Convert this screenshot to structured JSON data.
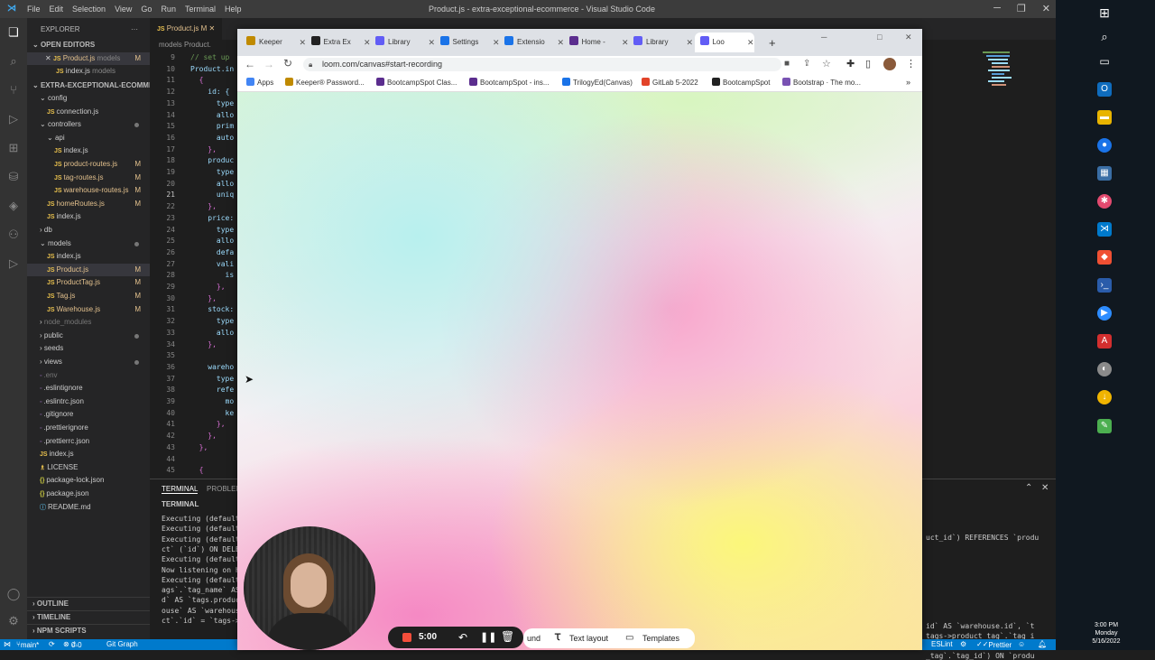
{
  "vscode": {
    "menu": [
      "File",
      "Edit",
      "Selection",
      "View",
      "Go",
      "Run",
      "Terminal",
      "Help"
    ],
    "window_title": "Product.js - extra-exceptional-ecommerce - Visual Studio Code",
    "tab_label": "Product.js M",
    "breadcrumb": "models  Product.",
    "explorer_title": "EXPLORER",
    "open_editors": "OPEN EDITORS",
    "open_editor_items": [
      {
        "name": "Product.js",
        "path": "models",
        "mark": "M"
      },
      {
        "name": "index.js",
        "path": "models",
        "mark": ""
      }
    ],
    "project": "EXTRA-EXCEPTIONAL-ECOMME...",
    "tree": [
      {
        "label": "config",
        "mark": ""
      },
      {
        "label": "connection.js",
        "mark": ""
      },
      {
        "label": "controllers",
        "mark": ""
      },
      {
        "label": "api",
        "mark": ""
      },
      {
        "label": "index.js",
        "mark": ""
      },
      {
        "label": "product-routes.js",
        "mark": "M"
      },
      {
        "label": "tag-routes.js",
        "mark": "M"
      },
      {
        "label": "warehouse-routes.js",
        "mark": "M"
      },
      {
        "label": "homeRoutes.js",
        "mark": "M"
      },
      {
        "label": "index.js",
        "mark": ""
      },
      {
        "label": "db",
        "mark": ""
      },
      {
        "label": "models",
        "mark": ""
      },
      {
        "label": "index.js",
        "mark": ""
      },
      {
        "label": "Product.js",
        "mark": "M"
      },
      {
        "label": "ProductTag.js",
        "mark": "M"
      },
      {
        "label": "Tag.js",
        "mark": "M"
      },
      {
        "label": "Warehouse.js",
        "mark": "M"
      },
      {
        "label": "node_modules",
        "mark": ""
      },
      {
        "label": "public",
        "mark": ""
      },
      {
        "label": "seeds",
        "mark": ""
      },
      {
        "label": "views",
        "mark": ""
      },
      {
        "label": ".env",
        "mark": ""
      },
      {
        "label": ".eslintignore",
        "mark": ""
      },
      {
        "label": ".eslintrc.json",
        "mark": ""
      },
      {
        "label": ".gitignore",
        "mark": ""
      },
      {
        "label": ".prettierignore",
        "mark": ""
      },
      {
        "label": ".prettierrc.json",
        "mark": ""
      },
      {
        "label": "index.js",
        "mark": ""
      },
      {
        "label": "LICENSE",
        "mark": ""
      },
      {
        "label": "package-lock.json",
        "mark": ""
      },
      {
        "label": "package.json",
        "mark": ""
      },
      {
        "label": "README.md",
        "mark": ""
      }
    ],
    "outline": "OUTLINE",
    "timeline": "TIMELINE",
    "npm": "NPM SCRIPTS",
    "line_numbers": [
      "9",
      "10",
      "11",
      "12",
      "13",
      "14",
      "15",
      "16",
      "17",
      "18",
      "19",
      "20",
      "21",
      "22",
      "23",
      "24",
      "25",
      "26",
      "27",
      "28",
      "29",
      "30",
      "31",
      "32",
      "33",
      "34",
      "35",
      "36",
      "37",
      "38",
      "39",
      "40",
      "41",
      "42",
      "43",
      "44",
      "45"
    ],
    "code_lines": [
      "// set up",
      "Product.in",
      "  {",
      "    id: {",
      "      type",
      "      allo",
      "      prim",
      "      auto",
      "    },",
      "    produc",
      "      type",
      "      allo",
      "      uniq",
      "    },",
      "    price:",
      "      type",
      "      allo",
      "      defa",
      "      vali",
      "        is",
      "      },",
      "    },",
      "    stock:",
      "      type",
      "      allo",
      "    },",
      "",
      "    wareho",
      "      type",
      "      refe",
      "        mo",
      "        ke",
      "      },",
      "    },",
      "  },",
      "",
      "  {"
    ],
    "panel_tabs": [
      "TERMINAL",
      "PROBLEM"
    ],
    "terminal_label": "TERMINAL",
    "terminal_left": [
      "Executing (default",
      "Executing (default",
      "Executing (default",
      "ct` (`id`) ON DELE",
      "Executing (default",
      "Now listening on h",
      "Executing (default",
      "ags`.`tag_name` AS",
      "d` AS `tags.produc",
      "ouse` AS `warehous",
      "ct`.`id` = `tags->"
    ],
    "terminal_right": [
      "uct_id`) REFERENCES `produ",
      "",
      "",
      "id` AS `warehouse.id`, `t",
      "tags->product_tag`.`tag_i",
      "` LEFT OUTER JOIN `wareh",
      "_tag`.`tag_id`) ON `produ"
    ],
    "status": {
      "branch": "main*",
      "errors": "0",
      "warnings": "0",
      "gitgraph": "Git Graph",
      "eslint": "ESLint",
      "prettier": "Prettier"
    }
  },
  "chrome": {
    "tabs": [
      "Keeper",
      "Extra Ex",
      "Library",
      "Settings",
      "Extensio",
      "Home -",
      "Library",
      "Loo"
    ],
    "url": "loom.com/canvas#start-recording",
    "bookmarks": [
      "Apps",
      "Keeper® Password...",
      "BootcampSpot Clas...",
      "BootcampSpot - ins...",
      "TrilogyEd(Canvas)",
      "GitLab 5-2022",
      "BootcampSpot",
      "Bootstrap · The mo..."
    ],
    "more": "»"
  },
  "loom": {
    "timer": "5:00",
    "sound_label": "und",
    "text_layout": "Text layout",
    "templates": "Templates"
  },
  "taskbar": {
    "time": "3:00 PM",
    "day": "Monday",
    "date": "5/16/2022"
  },
  "colors": {
    "accent": "#007acc",
    "record": "#f44e3b"
  }
}
